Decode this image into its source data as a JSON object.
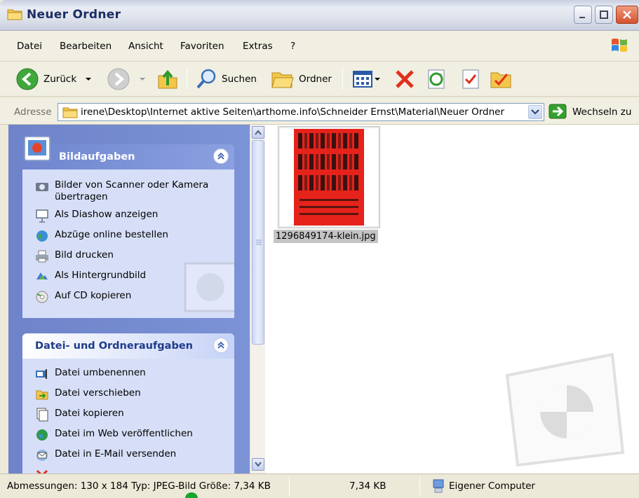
{
  "window": {
    "title": "Neuer Ordner"
  },
  "menu": [
    "Datei",
    "Bearbeiten",
    "Ansicht",
    "Favoriten",
    "Extras",
    "?"
  ],
  "toolbar": {
    "back": "Zurück",
    "search": "Suchen",
    "folders": "Ordner"
  },
  "address": {
    "label": "Adresse",
    "path": "irene\\Desktop\\Internet aktive Seiten\\arthome.info\\Schneider Ernst\\Material\\Neuer Ordner",
    "go": "Wechseln zu"
  },
  "panels": {
    "image_tasks": {
      "title": "Bildaufgaben",
      "items": [
        {
          "label": "Bilder von Scanner oder Kamera übertragen",
          "icon": "camera-icon"
        },
        {
          "label": "Als Diashow anzeigen",
          "icon": "slideshow-icon"
        },
        {
          "label": "Abzüge online bestellen",
          "icon": "globe-icon"
        },
        {
          "label": "Bild drucken",
          "icon": "printer-icon"
        },
        {
          "label": "Als Hintergrundbild",
          "icon": "desktop-icon"
        },
        {
          "label": "Auf CD kopieren",
          "icon": "cd-icon"
        }
      ]
    },
    "file_tasks": {
      "title": "Datei- und Ordneraufgaben",
      "items": [
        {
          "label": "Datei umbenennen",
          "icon": "rename-icon"
        },
        {
          "label": "Datei verschieben",
          "icon": "move-icon"
        },
        {
          "label": "Datei kopieren",
          "icon": "copy-icon"
        },
        {
          "label": "Datei im Web veröffentlichen",
          "icon": "web-publish-icon"
        },
        {
          "label": "Datei in E-Mail versenden",
          "icon": "email-icon"
        }
      ]
    }
  },
  "files": [
    {
      "name": "1296849174-klein.jpg",
      "selected": true,
      "poster_text": [
        "FORUM",
        "JUNGER",
        "KUNST"
      ]
    }
  ],
  "status": {
    "details": "Abmessungen: 130 x 184 Typ: JPEG-Bild Größe: 7,34 KB",
    "size": "7,34 KB",
    "zone": "Eigener Computer"
  },
  "colors": {
    "accent": "#0055e5",
    "task_pane": "#7c93d6",
    "selection": "#c4c4c4",
    "delete_red": "#e0301e"
  }
}
